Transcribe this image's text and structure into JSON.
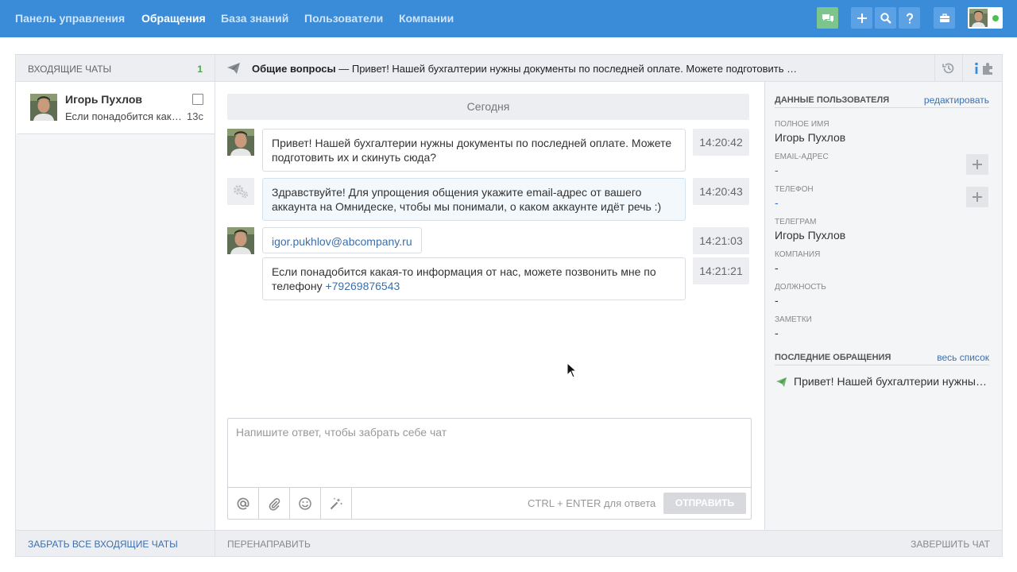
{
  "nav": {
    "items": [
      {
        "label": "Панель управления"
      },
      {
        "label": "Обращения"
      },
      {
        "label": "База знаний"
      },
      {
        "label": "Пользователи"
      },
      {
        "label": "Компании"
      }
    ],
    "icons": [
      "chat-icon",
      "plus-icon",
      "search-icon",
      "help-icon",
      "briefcase-icon"
    ],
    "status_color": "#4ec04e",
    "accent_color": "#3a8cd8"
  },
  "inbox": {
    "title": "Входящие чаты",
    "count": "1",
    "chat": {
      "name": "Игорь Пухлов",
      "preview": "Если понадобится какая-то информация от нас, можете позвонить мне по телефону",
      "time": "13с"
    },
    "take_all": "Забрать все входящие чаты"
  },
  "subject": {
    "category": "Общие вопросы",
    "dash": " — ",
    "text": "Привет! Нашей бухгалтерии нужны документы по последней оплате. Можете подготовить их и скинуть сюда?"
  },
  "chat": {
    "day": "Сегодня",
    "messages": [
      {
        "text": "Привет! Нашей бухгалтерии нужны документы по последней оплате. Можете подготовить их и скинуть сюда?",
        "time": "14:20:42"
      },
      {
        "text": "Здравствуйте! Для упрощения общения укажите email-адрес от вашего аккаунта на Омнидеске, чтобы мы понимали, о каком аккаунте идёт речь :)",
        "time": "14:20:43"
      },
      {
        "text": "igor.pukhlov@abcompany.ru",
        "time": "14:21:03"
      },
      {
        "text": "Если понадобится какая-то информация от нас, можете позвонить мне по телефону ",
        "phone": "+79269876543",
        "time": "14:21:21"
      }
    ]
  },
  "composer": {
    "placeholder": "Напишите ответ, чтобы забрать себе чат",
    "hint": "CTRL + ENTER для ответа",
    "send": "Отправить"
  },
  "footer": {
    "forward": "Перенаправить",
    "finish": "Завершить чат"
  },
  "user": {
    "header": "Данные пользователя",
    "edit": "редактировать",
    "fields": [
      {
        "label": "Полное имя",
        "value": "Игорь Пухлов"
      },
      {
        "label": "Email-адрес",
        "value": "-"
      },
      {
        "label": "Телефон",
        "value": "-"
      },
      {
        "label": "Телеграм",
        "value": "Игорь Пухлов"
      },
      {
        "label": "Компания",
        "value": "-"
      },
      {
        "label": "Должность",
        "value": "-"
      },
      {
        "label": "Заметки",
        "value": "-"
      }
    ],
    "recent_header": "Последние обращения",
    "recent_all": "весь список",
    "recent_item": "Привет! Нашей бухгалтерии нужны документы по последней оплате. Можете подготовить их и скинуть сюда?"
  }
}
